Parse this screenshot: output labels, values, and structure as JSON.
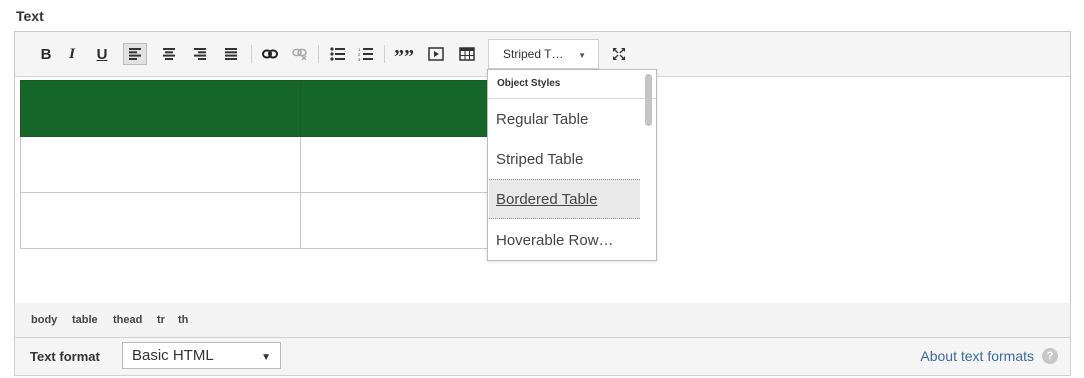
{
  "field": {
    "label": "Text"
  },
  "toolbar": {
    "bold": "B",
    "italic": "I",
    "underline": "U",
    "blockquote": "””",
    "styles_value": "Striped T…",
    "styles_caret": "▼"
  },
  "dropdown": {
    "title": "Object Styles",
    "items": [
      {
        "label": "Regular Table"
      },
      {
        "label": "Striped Table"
      },
      {
        "label": "Bordered Table",
        "hovered": true
      },
      {
        "label": "Hoverable Row…"
      }
    ]
  },
  "table": {
    "header_color": "#166629",
    "rows": 3,
    "cols": 2
  },
  "path": [
    "body",
    "table",
    "thead",
    "tr",
    "th"
  ],
  "format": {
    "label": "Text format",
    "value": "Basic HTML",
    "caret": "▼",
    "about_link": "About text formats",
    "help_icon": "?"
  },
  "colors": {
    "link": "#3a6aa0",
    "table_header": "#166629"
  }
}
